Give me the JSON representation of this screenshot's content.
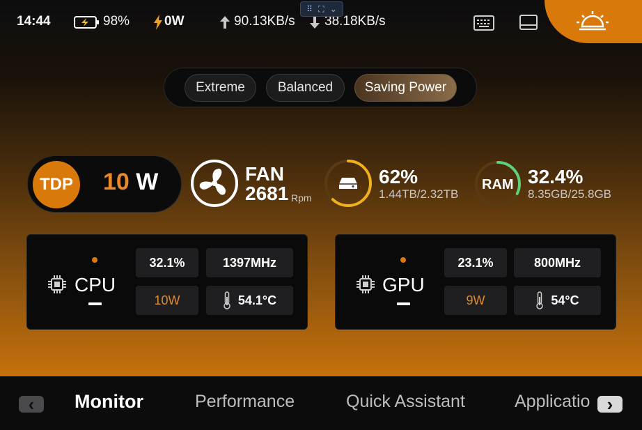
{
  "status_bar": {
    "time": "14:44",
    "battery_percent": "98%",
    "power_draw": "0W",
    "upload": "90.13KB/s",
    "download": "38.18KB/s",
    "icons": [
      "battery-charging-icon",
      "bolt-icon",
      "arrow-up-icon",
      "arrow-down-icon",
      "keyboard-icon",
      "tablet-icon",
      "light-icon"
    ]
  },
  "modes": {
    "items": [
      {
        "label": "Extreme"
      },
      {
        "label": "Balanced"
      },
      {
        "label": "Saving Power"
      }
    ],
    "active": "Saving Power"
  },
  "tdp": {
    "label": "TDP",
    "value": "10",
    "unit": "W"
  },
  "fan": {
    "label": "FAN",
    "value": "2681",
    "unit": "Rpm"
  },
  "storage": {
    "percent_text": "62%",
    "percent": 0.62,
    "detail": "1.44TB/2.32TB"
  },
  "ram": {
    "label": "RAM",
    "percent_text": "32.4%",
    "percent": 0.324,
    "detail": "8.35GB/25.8GB"
  },
  "cpu": {
    "title": "CPU",
    "usage": "32.1%",
    "clock": "1397MHz",
    "power": "10W",
    "temp": "54.1°C"
  },
  "gpu": {
    "title": "GPU",
    "usage": "23.1%",
    "clock": "800MHz",
    "power": "9W",
    "temp": "54°C"
  },
  "nav": {
    "items": [
      {
        "label": "Monitor"
      },
      {
        "label": "Performance"
      },
      {
        "label": "Quick Assistant"
      },
      {
        "label": "Applicatio"
      }
    ],
    "active": "Monitor",
    "prev": "‹",
    "next": "›"
  },
  "colors": {
    "accent": "#d9790a",
    "ring_storage": "#f0b020",
    "ring_ram": "#5fd07a"
  }
}
